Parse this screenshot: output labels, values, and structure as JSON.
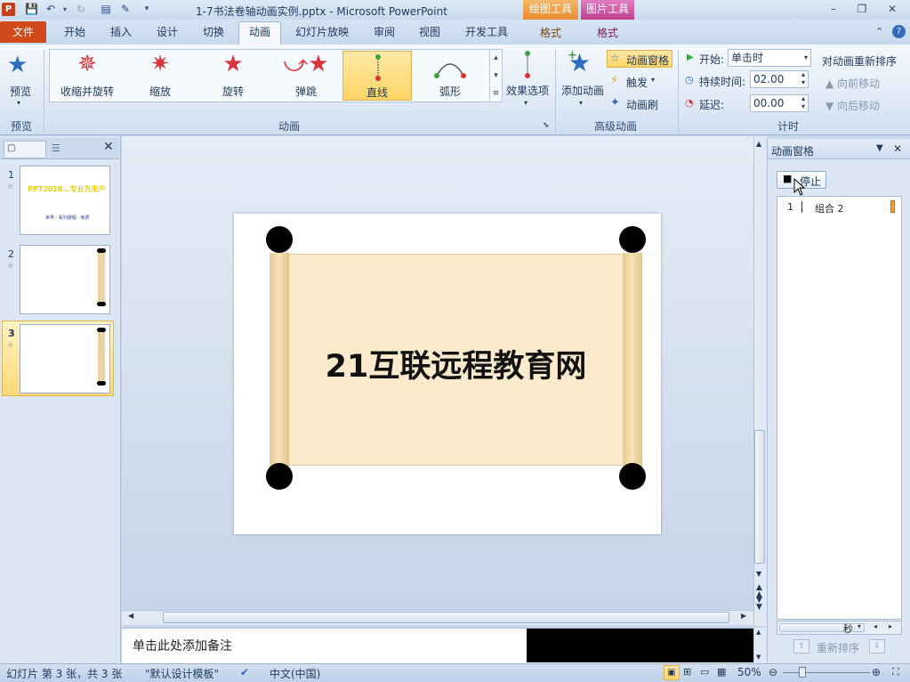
{
  "window": {
    "title": "1-7书法卷轴动画实例.pptx - Microsoft PowerPoint",
    "app_icon": "P",
    "contextual_tabs": {
      "drawing_tools": "绘图工具",
      "picture_tools": "图片工具",
      "format1": "格式",
      "format2": "格式"
    },
    "controls": {
      "minimize": "–",
      "restore": "❐",
      "close": "✕"
    }
  },
  "tabs": {
    "file": "文件",
    "items": [
      "开始",
      "插入",
      "设计",
      "切换",
      "动画",
      "幻灯片放映",
      "审阅",
      "视图",
      "开发工具"
    ],
    "active": "动画"
  },
  "ribbon": {
    "preview": {
      "label": "预览",
      "group": "预览"
    },
    "gallery": {
      "group": "动画",
      "items": [
        {
          "label": "收缩并旋转",
          "icon": "shrink-spin-icon"
        },
        {
          "label": "缩放",
          "icon": "zoom-icon"
        },
        {
          "label": "旋转",
          "icon": "spin-icon"
        },
        {
          "label": "弹跳",
          "icon": "bounce-icon"
        },
        {
          "label": "直线",
          "icon": "line-path-icon"
        },
        {
          "label": "弧形",
          "icon": "arc-path-icon"
        }
      ],
      "selected": "直线"
    },
    "effect_options": "效果选项",
    "advanced": {
      "group": "高级动画",
      "add_animation": "添加动画",
      "animation_pane": "动画窗格",
      "trigger": "触发",
      "painter": "动画刷"
    },
    "timing": {
      "group": "计时",
      "start_label": "开始:",
      "start_value": "单击时",
      "duration_label": "持续时间:",
      "duration_value": "02.00",
      "delay_label": "延迟:",
      "delay_value": "00.00",
      "reorder_title": "对动画重新排序",
      "move_earlier": "向前移动",
      "move_later": "向后移动"
    }
  },
  "slides": [
    {
      "number": "1",
      "thumb_text": "PPT2010…专业为用户",
      "thumb_sub": "世界 · 系列课程 · 免费"
    },
    {
      "number": "2"
    },
    {
      "number": "3"
    }
  ],
  "slide": {
    "text": "21互联远程教育网"
  },
  "notes": {
    "placeholder": "单击此处添加备注"
  },
  "animation_pane": {
    "title": "动画窗格",
    "stop": "停止",
    "items": [
      {
        "index": "1",
        "name": "组合 2"
      }
    ],
    "seconds": "秒",
    "reorder": "重新排序"
  },
  "status": {
    "slide_info": "幻灯片 第 3 张，共 3 张",
    "theme": "\"默认设计模板\"",
    "language": "中文(中国)",
    "zoom": "50%"
  },
  "colors": {
    "file_tab": "#d04a1b",
    "drawing_tools": "#f0a04a",
    "picture_tools": "#c84a9a",
    "selected": "#ffd564"
  }
}
